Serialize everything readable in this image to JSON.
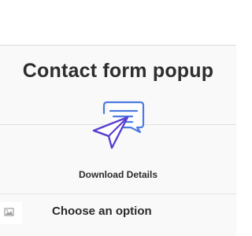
{
  "popup": {
    "title": "Contact form popup",
    "download_label": "Download Details",
    "choose_label": "Choose an option"
  },
  "icons": {
    "main": "send-message-icon",
    "thumbnail": "broken-image-icon"
  },
  "colors": {
    "accent": "#4d7be0",
    "plane": "#5a3fd1",
    "title": "#2e2e2e"
  }
}
